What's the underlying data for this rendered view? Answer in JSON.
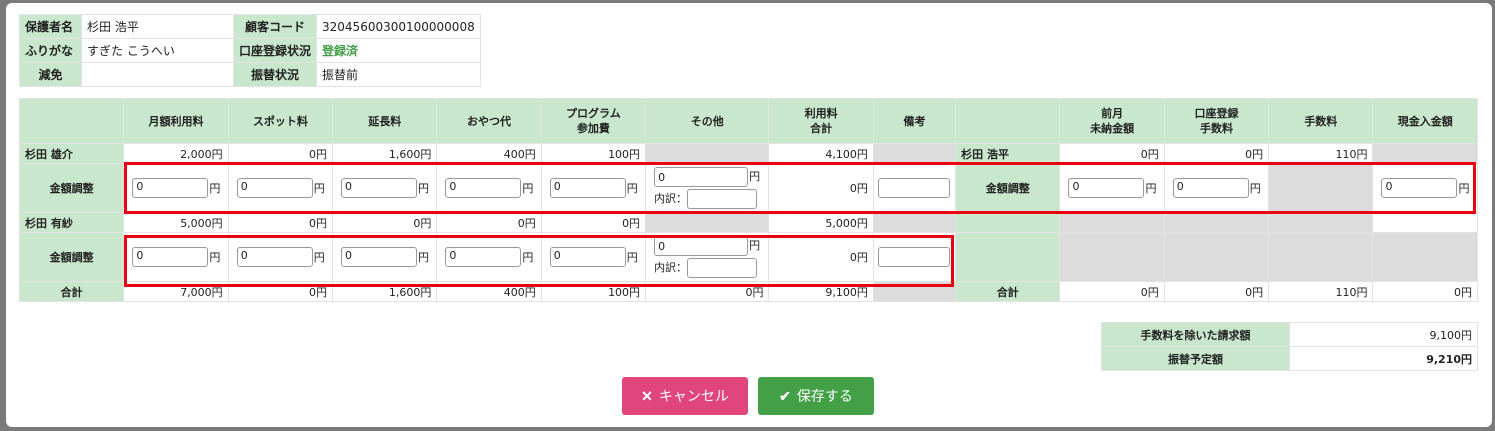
{
  "info": {
    "guardian_label": "保護者名",
    "guardian_value": "杉田 浩平",
    "kana_label": "ふりがな",
    "kana_value": "すぎた こうへい",
    "exemption_label": "減免",
    "exemption_value": "",
    "customer_code_label": "顧客コード",
    "customer_code_value": "32045600300100000008",
    "account_status_label": "口座登録状況",
    "account_status_value": "登録済",
    "transfer_status_label": "振替状況",
    "transfer_status_value": "振替前"
  },
  "headers": {
    "monthly": "月額利用料",
    "spot": "スポット料",
    "extension": "延長料",
    "snack": "おやつ代",
    "program_l1": "プログラム",
    "program_l2": "参加費",
    "other": "その他",
    "total_l1": "利用料",
    "total_l2": "合計",
    "remarks": "備考",
    "prev_l1": "前月",
    "prev_l2": "未納金額",
    "acctfee_l1": "口座登録",
    "acctfee_l2": "手数料",
    "fee": "手数料",
    "cash": "現金入金額"
  },
  "rows": {
    "child1": {
      "name": "杉田 雄介",
      "monthly": "2,000円",
      "spot": "0円",
      "extension": "1,600円",
      "snack": "400円",
      "program": "100円",
      "total": "4,100円"
    },
    "guardian_row": {
      "name": "杉田 浩平",
      "prev": "0円",
      "acctfee": "0円",
      "fee": "110円"
    },
    "adj_label": "金額調整",
    "adj1": {
      "v": "0",
      "total": "0円"
    },
    "child2": {
      "name": "杉田 有紗",
      "monthly": "5,000円",
      "spot": "0円",
      "extension": "0円",
      "snack": "0円",
      "program": "0円",
      "total": "5,000円"
    },
    "adj2": {
      "v": "0",
      "total": "0円"
    },
    "sum": {
      "label": "合計",
      "monthly": "7,000円",
      "spot": "0円",
      "extension": "1,600円",
      "snack": "400円",
      "program": "100円",
      "other": "0円",
      "total": "9,100円",
      "prev": "0円",
      "acctfee": "0円",
      "fee": "110円",
      "cash": "0円"
    },
    "yen": "円",
    "breakdown_label": "内訳："
  },
  "summary": {
    "excl_fee_label": "手数料を除いた請求額",
    "excl_fee_value": "9,100円",
    "planned_label": "振替予定額",
    "planned_value": "9,210円"
  },
  "buttons": {
    "cancel": "キャンセル",
    "save": "保存する"
  },
  "icons": {
    "cancel": "x-icon",
    "save": "check-icon"
  },
  "colors": {
    "header_green": "#c9e7cc",
    "highlight_red": "#e60012",
    "cancel_pink": "#e0457b",
    "save_green": "#43a047"
  }
}
